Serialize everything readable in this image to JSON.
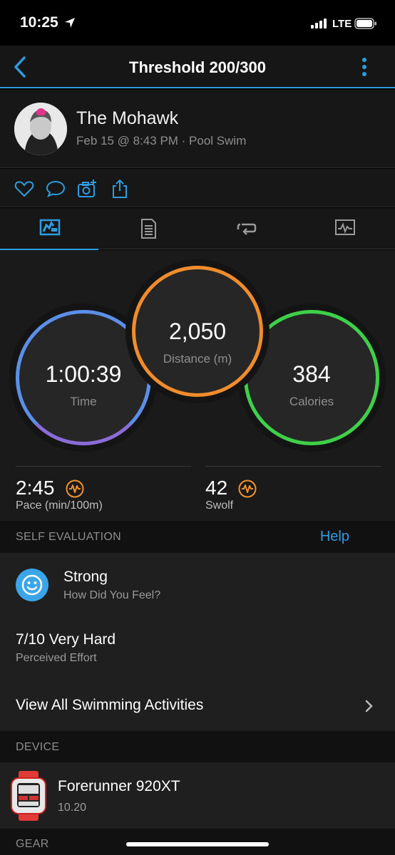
{
  "status_bar": {
    "time": "10:25",
    "network": "LTE"
  },
  "nav": {
    "title": "Threshold 200/300"
  },
  "profile": {
    "name": "The Mohawk",
    "meta": "Feb 15 @ 8:43 PM · Pool Swim"
  },
  "actions": [
    "heart-icon",
    "comment-icon",
    "add-photo-icon",
    "share-icon"
  ],
  "tabs": [
    "summary-icon",
    "details-icon",
    "laps-icon",
    "chart-icon"
  ],
  "summary": {
    "time": {
      "value": "1:00:39",
      "label": "Time",
      "color": "#5b8fe8"
    },
    "distance": {
      "value": "2,050",
      "label": "Distance (m)",
      "color": "#f08c2c"
    },
    "calories": {
      "value": "384",
      "label": "Calories",
      "color": "#3fd04a"
    }
  },
  "stats": {
    "pace": {
      "value": "2:45",
      "label": "Pace (min/100m)"
    },
    "swolf": {
      "value": "42",
      "label": "Swolf"
    }
  },
  "self_evaluation": {
    "header": "SELF EVALUATION",
    "help": "Help",
    "feel_value": "Strong",
    "feel_label": "How Did You Feel?",
    "effort_value": "7/10 Very Hard",
    "effort_label": "Perceived Effort",
    "view_all": "View All Swimming Activities"
  },
  "device": {
    "header": "DEVICE",
    "name": "Forerunner 920XT",
    "version": "10.20"
  },
  "gear": {
    "header": "GEAR"
  },
  "colors": {
    "accent": "#2f9ce0",
    "highlight": "#f0922e"
  }
}
